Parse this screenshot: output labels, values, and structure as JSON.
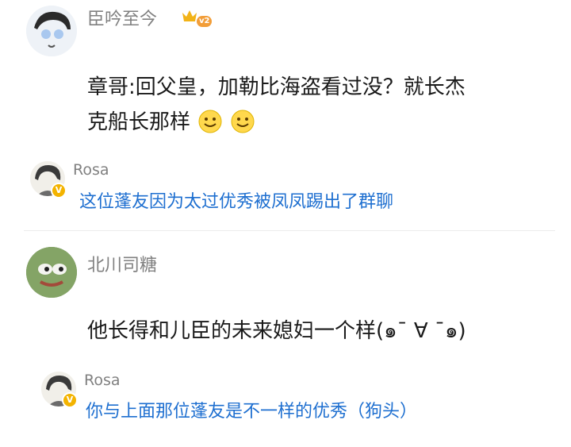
{
  "comments": [
    {
      "username": "臣吟至今",
      "level_badge": "v2",
      "text_line1": "章哥:回父皇，加勒比海盗看过没？就长杰",
      "text_line2": "克船长那样",
      "emoji": "smile-emoji"
    },
    {
      "reply_username": "Rosa",
      "reply_text": "这位蓬友因为太过优秀被凤凤踢出了群聊",
      "badge": "V"
    },
    {
      "username": "北川司糖",
      "text": "他长得和儿臣的未来媳妇一个样(๑¯ ∀ ¯๑)"
    },
    {
      "reply_username": "Rosa",
      "reply_text": "你与上面那位蓬友是不一样的优秀（狗头）",
      "badge": "V"
    }
  ],
  "colors": {
    "link_blue": "#1e6fd0",
    "name_gray": "#808080",
    "crown_gold": "#f2b318"
  }
}
